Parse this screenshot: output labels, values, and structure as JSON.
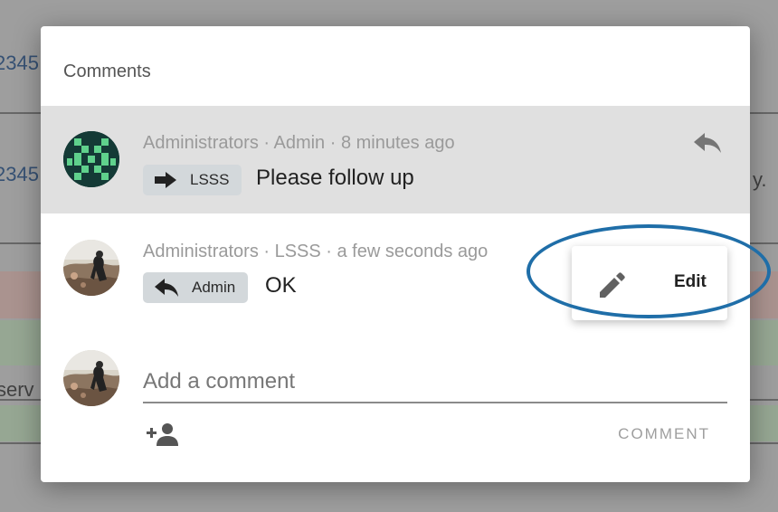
{
  "dialog": {
    "title": "Comments",
    "comments": [
      {
        "meta": "Administrators · Admin · 8 minutes ago",
        "chip_icon": "arrow-right-icon",
        "chip_label": "LSSS",
        "text": "Please follow up"
      },
      {
        "meta": "Administrators · LSSS · a few seconds ago",
        "chip_icon": "reply-icon",
        "chip_label": "Admin",
        "text": "OK"
      }
    ],
    "context_menu": {
      "items": [
        {
          "icon": "pencil-icon",
          "label": "Edit"
        }
      ]
    },
    "composer": {
      "placeholder": "Add a comment",
      "add_person_icon": "person-add-icon",
      "submit_label": "COMMENT"
    }
  },
  "background": {
    "fragments": [
      "2345",
      "2345",
      "serv",
      "y."
    ]
  },
  "colors": {
    "highlight_row": "#e0e0e0",
    "chip_bg": "#d3d8db",
    "annotation": "#1f6ea8"
  }
}
